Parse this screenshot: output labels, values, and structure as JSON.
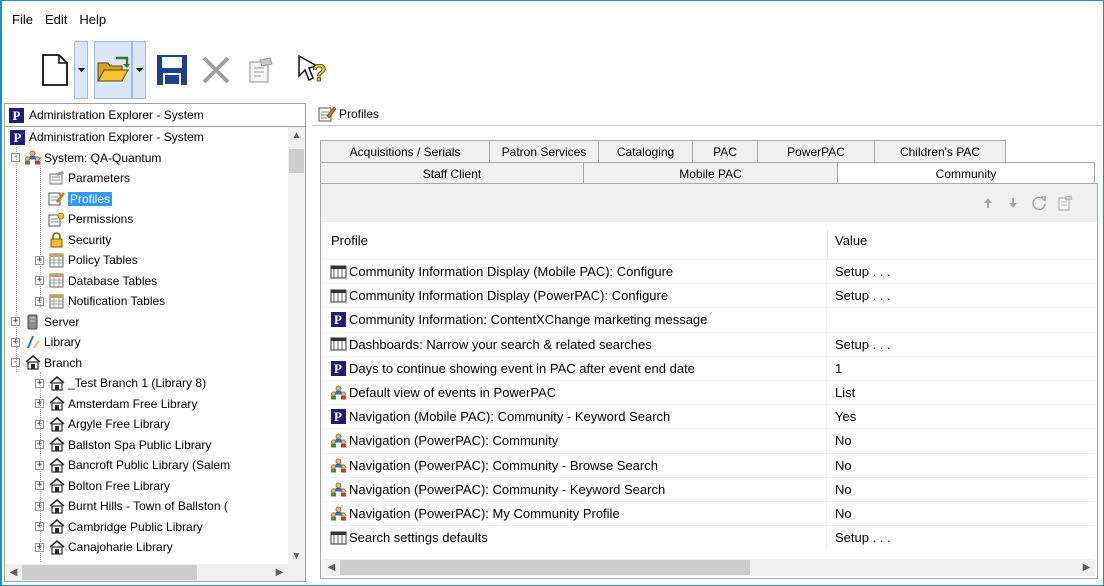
{
  "menu": {
    "file": "File",
    "edit": "Edit",
    "help": "Help"
  },
  "left": {
    "header_title": "Administration Explorer - System",
    "tree": [
      {
        "label": "Administration Explorer - System",
        "icon": "polaris-p-icon",
        "depth": 0,
        "expander": ""
      },
      {
        "label": "System: QA-Quantum",
        "icon": "users-icon",
        "depth": 1,
        "expander": "-"
      },
      {
        "label": "Parameters",
        "icon": "parameters-icon",
        "depth": 2,
        "expander": ""
      },
      {
        "label": "Profiles",
        "icon": "profiles-icon",
        "depth": 2,
        "expander": "",
        "selected": true
      },
      {
        "label": "Permissions",
        "icon": "permissions-icon",
        "depth": 2,
        "expander": ""
      },
      {
        "label": "Security",
        "icon": "lock-icon",
        "depth": 2,
        "expander": ""
      },
      {
        "label": "Policy Tables",
        "icon": "table-icon",
        "depth": 2,
        "expander": "+"
      },
      {
        "label": "Database Tables",
        "icon": "table-icon",
        "depth": 2,
        "expander": "+"
      },
      {
        "label": "Notification Tables",
        "icon": "table-icon",
        "depth": 2,
        "expander": "+"
      },
      {
        "label": "Server",
        "icon": "server-icon",
        "depth": 1,
        "expander": "+"
      },
      {
        "label": "Library",
        "icon": "library-icon",
        "depth": 1,
        "expander": "+"
      },
      {
        "label": "Branch",
        "icon": "branch-icon",
        "depth": 1,
        "expander": "-"
      },
      {
        "label": "_Test Branch 1 (Library 8)",
        "icon": "branch-icon",
        "depth": 2,
        "expander": "+"
      },
      {
        "label": "Amsterdam Free Library",
        "icon": "branch-icon",
        "depth": 2,
        "expander": "+"
      },
      {
        "label": "Argyle Free Library",
        "icon": "branch-icon",
        "depth": 2,
        "expander": "+"
      },
      {
        "label": "Ballston Spa Public Library",
        "icon": "branch-icon",
        "depth": 2,
        "expander": "+"
      },
      {
        "label": "Bancroft Public Library (Salem",
        "icon": "branch-icon",
        "depth": 2,
        "expander": "+"
      },
      {
        "label": "Bolton Free Library",
        "icon": "branch-icon",
        "depth": 2,
        "expander": "+"
      },
      {
        "label": "Burnt Hills - Town of Ballston (",
        "icon": "branch-icon",
        "depth": 2,
        "expander": "+"
      },
      {
        "label": "Cambridge Public Library",
        "icon": "branch-icon",
        "depth": 2,
        "expander": "+"
      },
      {
        "label": "Canajoharie Library",
        "icon": "branch-icon",
        "depth": 2,
        "expander": "+"
      }
    ]
  },
  "right": {
    "header_title": "Profiles",
    "tabs_row1": [
      "Acquisitions / Serials",
      "Patron Services",
      "Cataloging",
      "PAC",
      "PowerPAC",
      "Children's PAC"
    ],
    "tabs_row2": [
      "Staff Client",
      "Mobile PAC",
      "Community"
    ],
    "active_tab": "Community",
    "columns": {
      "profile": "Profile",
      "value": "Value"
    },
    "rows": [
      {
        "icon": "form-icon",
        "profile": "Community Information Display (Mobile PAC): Configure",
        "value": "Setup . . ."
      },
      {
        "icon": "form-icon",
        "profile": "Community Information Display (PowerPAC): Configure",
        "value": "Setup . . ."
      },
      {
        "icon": "polaris-p-icon",
        "profile": "Community Information: ContentXChange marketing message",
        "value": ""
      },
      {
        "icon": "form-icon",
        "profile": "Dashboards: Narrow your search & related searches",
        "value": "Setup . . ."
      },
      {
        "icon": "polaris-p-icon",
        "profile": "Days to continue showing event in PAC after event end date",
        "value": "1"
      },
      {
        "icon": "users-icon",
        "profile": "Default view of events in PowerPAC",
        "value": "List"
      },
      {
        "icon": "polaris-p-icon",
        "profile": "Navigation (Mobile PAC): Community - Keyword Search",
        "value": "Yes"
      },
      {
        "icon": "users-icon",
        "profile": "Navigation (PowerPAC): Community",
        "value": "No"
      },
      {
        "icon": "users-icon",
        "profile": "Navigation (PowerPAC): Community - Browse Search",
        "value": "No"
      },
      {
        "icon": "users-icon",
        "profile": "Navigation (PowerPAC): Community - Keyword Search",
        "value": "No"
      },
      {
        "icon": "users-icon",
        "profile": "Navigation (PowerPAC): My Community Profile",
        "value": "No"
      },
      {
        "icon": "form-icon",
        "profile": "Search settings defaults",
        "value": "Setup . . ."
      }
    ]
  },
  "colors": {
    "selection": "#3399ff",
    "polaris_blue": "#1e1e7a",
    "folder_yellow": "#f2c230",
    "save_blue": "#1c3f8e"
  }
}
